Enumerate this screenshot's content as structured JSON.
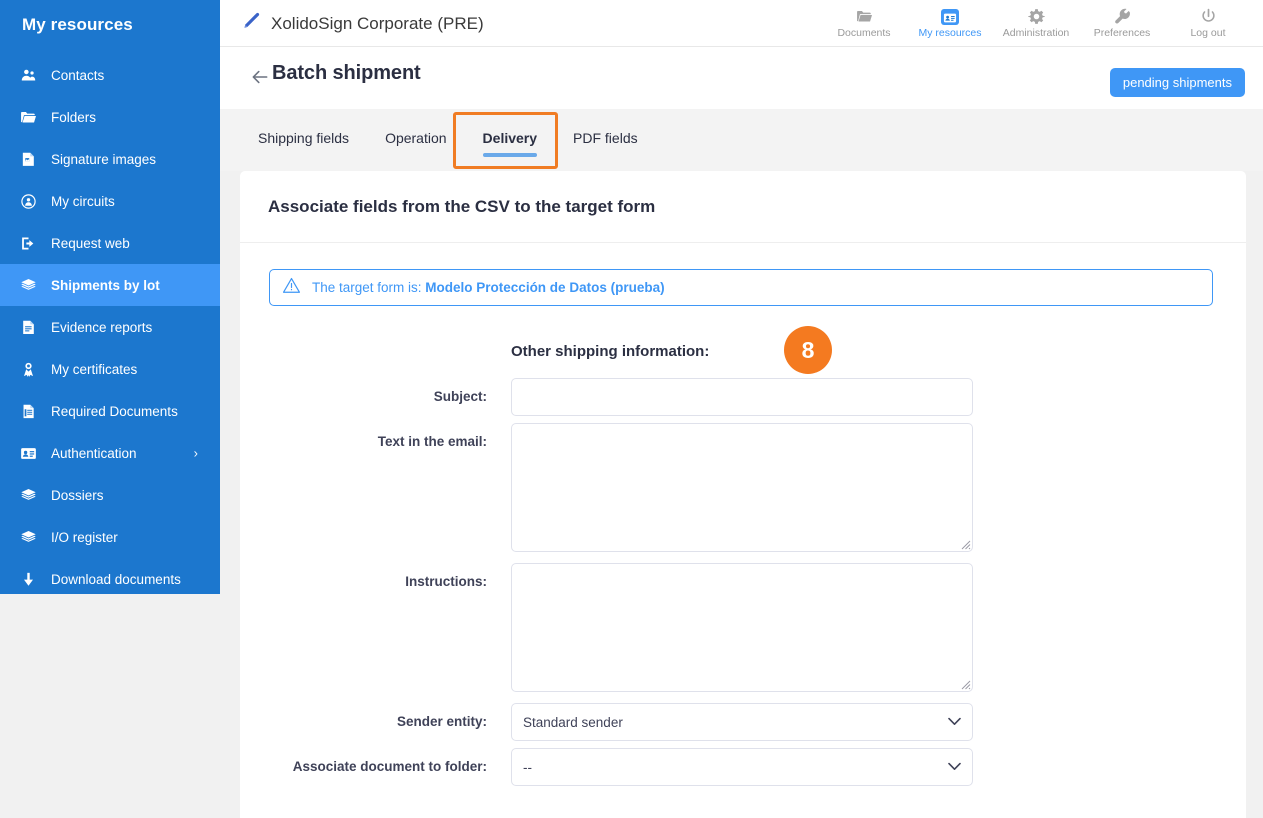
{
  "sidebar": {
    "title": "My resources",
    "items": [
      {
        "label": "Contacts",
        "icon": "contacts-icon",
        "active": false,
        "chevron": false
      },
      {
        "label": "Folders",
        "icon": "folder-icon",
        "active": false,
        "chevron": false
      },
      {
        "label": "Signature images",
        "icon": "signature-image-icon",
        "active": false,
        "chevron": false
      },
      {
        "label": "My circuits",
        "icon": "circuit-icon",
        "active": false,
        "chevron": false
      },
      {
        "label": "Request web",
        "icon": "request-web-icon",
        "active": false,
        "chevron": false
      },
      {
        "label": "Shipments by lot",
        "icon": "layers-icon",
        "active": true,
        "chevron": false
      },
      {
        "label": "Evidence reports",
        "icon": "report-icon",
        "active": false,
        "chevron": false
      },
      {
        "label": "My certificates",
        "icon": "certificate-icon",
        "active": false,
        "chevron": false
      },
      {
        "label": "Required Documents",
        "icon": "required-document-icon",
        "active": false,
        "chevron": false
      },
      {
        "label": "Authentication",
        "icon": "id-card-icon",
        "active": false,
        "chevron": true
      },
      {
        "label": "Dossiers",
        "icon": "layers-icon",
        "active": false,
        "chevron": false
      },
      {
        "label": "I/O register",
        "icon": "layers-icon",
        "active": false,
        "chevron": false
      },
      {
        "label": "Download documents",
        "icon": "download-icon",
        "active": false,
        "chevron": false
      }
    ],
    "chevron_glyph": "›"
  },
  "header": {
    "brand": "XolidoSign Corporate (PRE)",
    "brand_icon": "pen-icon",
    "nav": [
      {
        "label": "Documents",
        "icon": "folder-icon",
        "active": false
      },
      {
        "label": "My resources",
        "icon": "id-card-icon",
        "active": true
      },
      {
        "label": "Administration",
        "icon": "gear-icon",
        "active": false
      },
      {
        "label": "Preferences",
        "icon": "wrench-icon",
        "active": false
      },
      {
        "label": "Log out",
        "icon": "power-icon",
        "active": false
      }
    ]
  },
  "titlebar": {
    "back_icon": "arrow-left-icon",
    "title": "Batch shipment",
    "pending_button": "pending shipments"
  },
  "tabs": [
    {
      "label": "Shipping fields",
      "active": false
    },
    {
      "label": "Operation",
      "active": false
    },
    {
      "label": "Delivery",
      "active": true
    },
    {
      "label": "PDF fields",
      "active": false
    }
  ],
  "card": {
    "header_title": "Associate fields from the CSV to the target form",
    "alert": {
      "icon": "warning-triangle-icon",
      "prefix": "The target form is: ",
      "form_name": "Modelo Protección de Datos (prueba)"
    },
    "section_title": "Other shipping information:",
    "step_badge": "8",
    "fields": [
      {
        "label": "Subject:",
        "type": "text",
        "value": "",
        "placeholder": ""
      },
      {
        "label": "Text in the email:",
        "type": "textarea",
        "value": "",
        "placeholder": ""
      },
      {
        "label": "Instructions:",
        "type": "textarea",
        "value": "",
        "placeholder": ""
      },
      {
        "label": "Sender entity:",
        "type": "select",
        "value": "Standard sender"
      },
      {
        "label": "Associate document to folder:",
        "type": "select",
        "value": "--"
      }
    ]
  },
  "colors": {
    "sidebar_blue": "#1c77ce",
    "sidebar_active": "#3f97f6",
    "accent_blue": "#3f97f6",
    "highlight_orange": "#f07c23",
    "badge_orange": "#f47a20",
    "page_bg": "#f1f1f1",
    "tabstrip_bg": "#f3f3f3"
  }
}
